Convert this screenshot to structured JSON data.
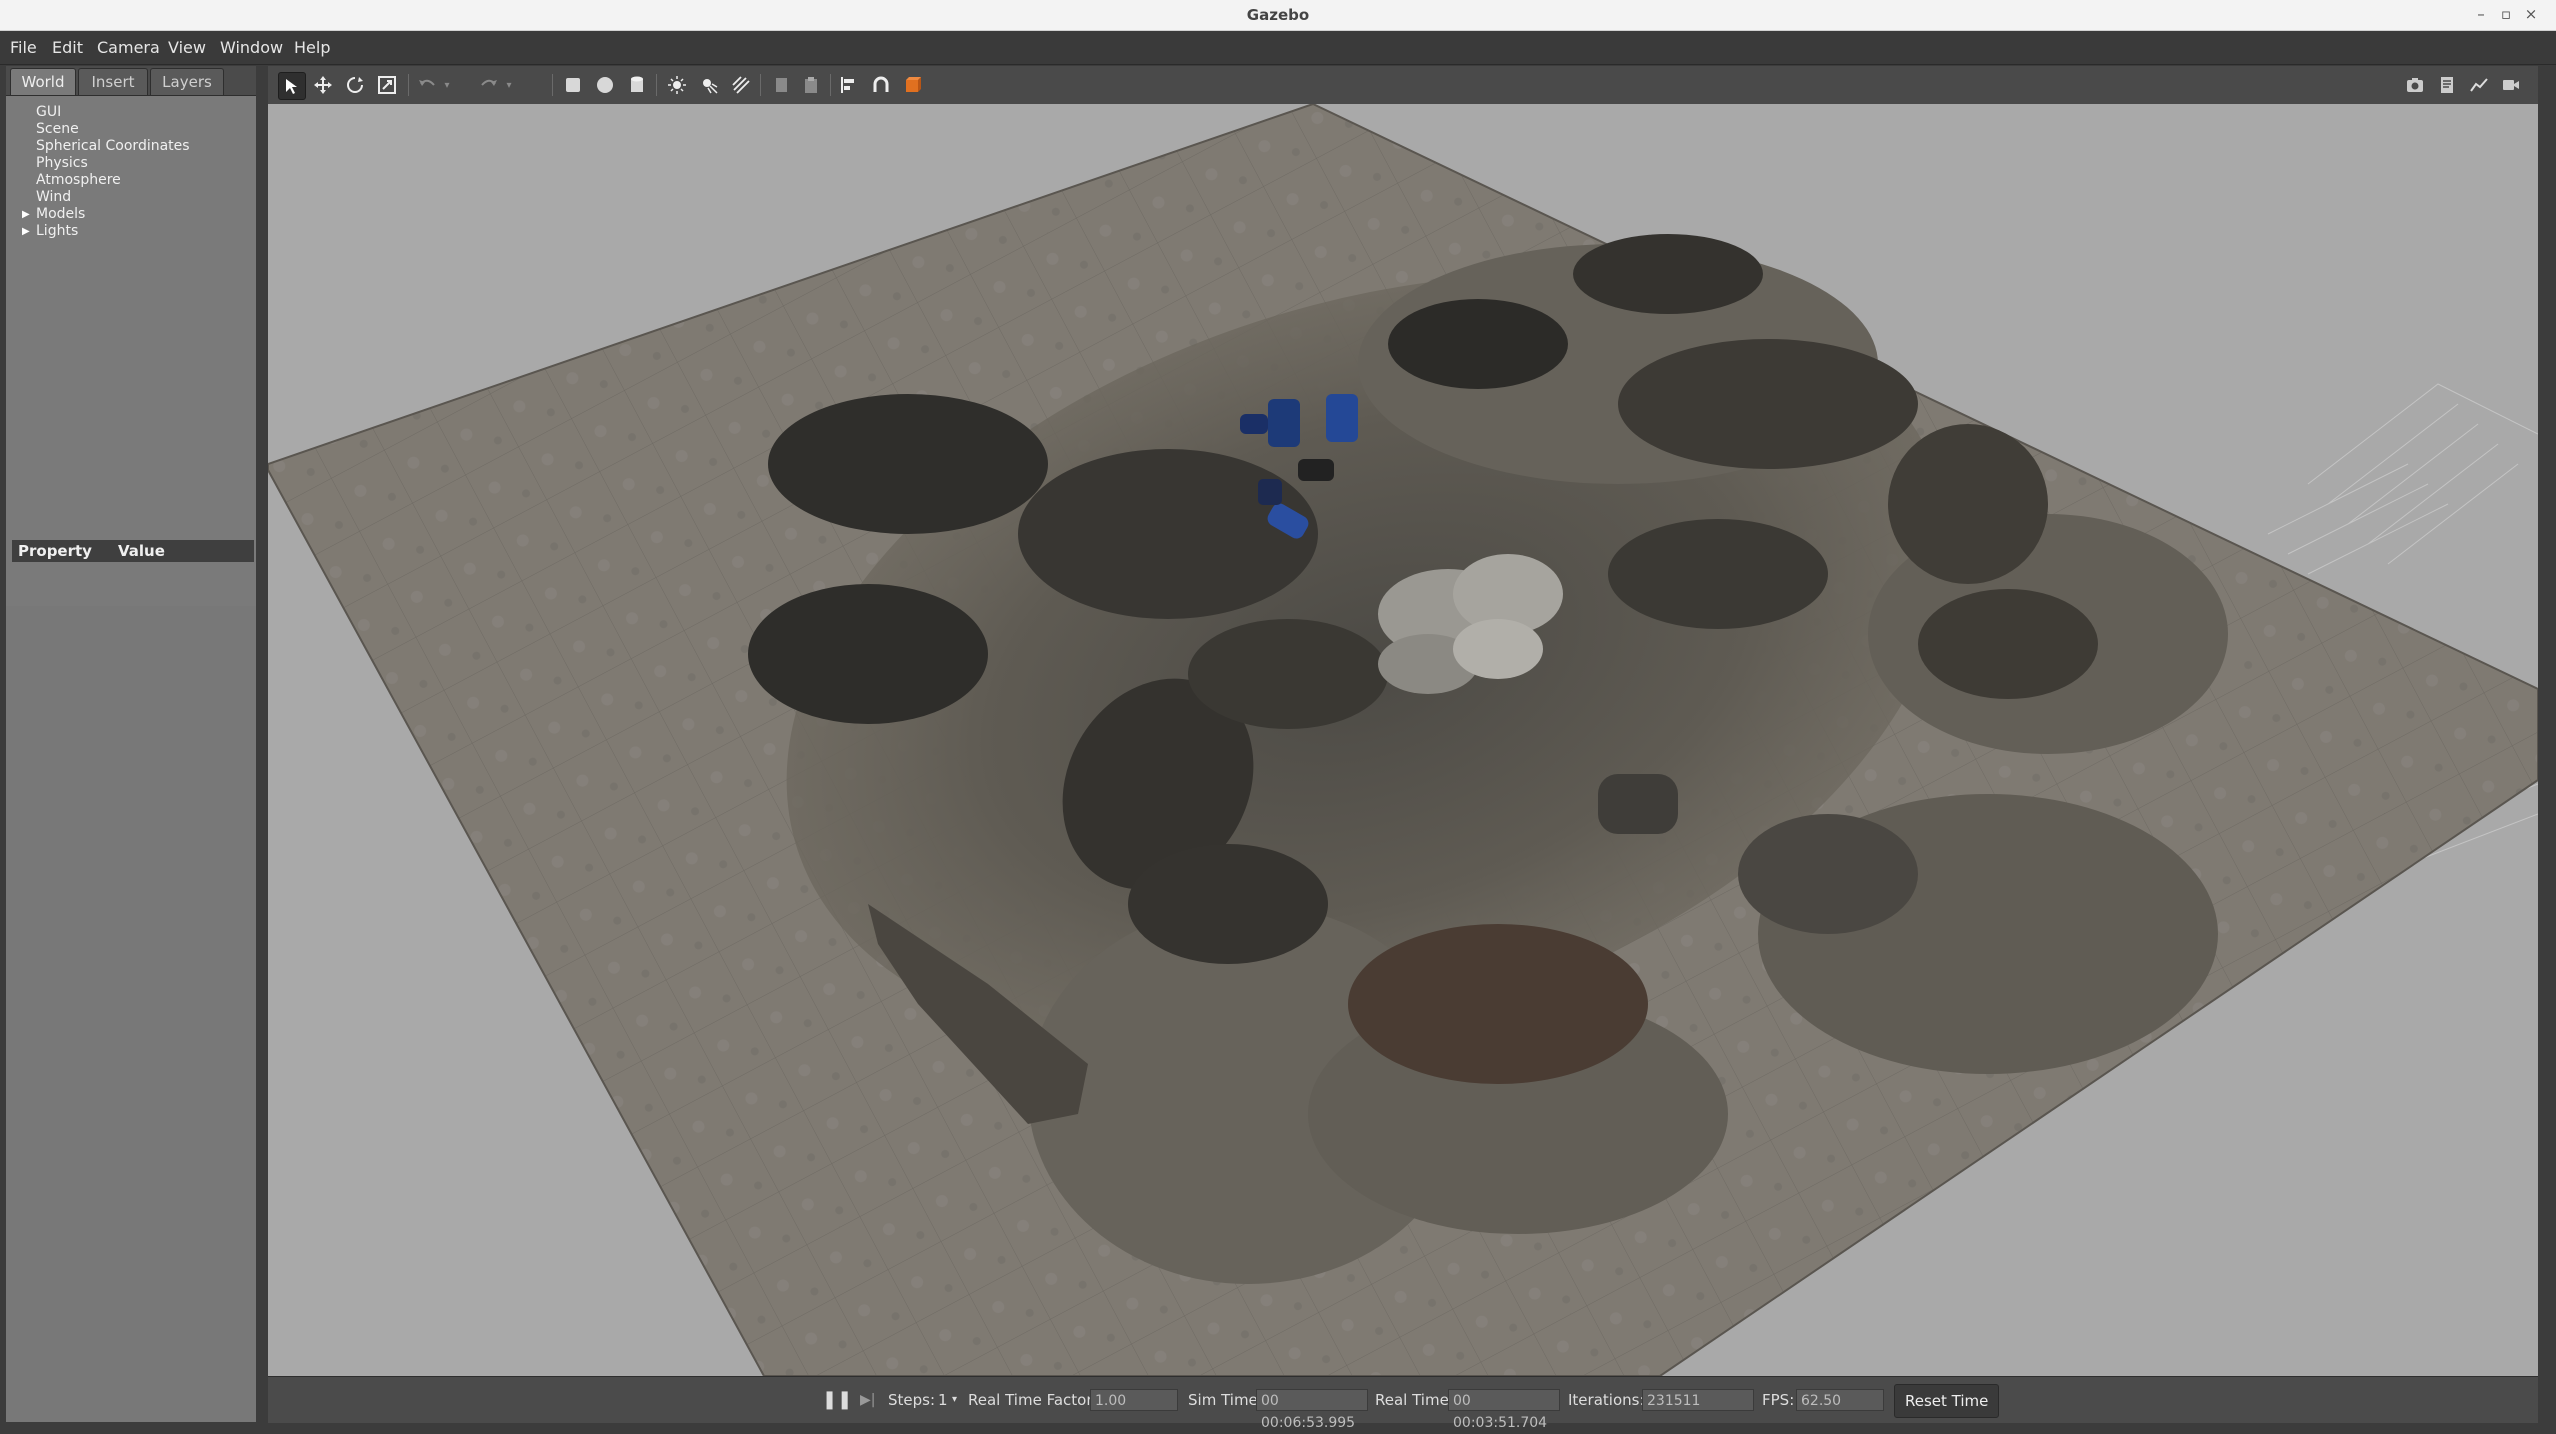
{
  "window": {
    "title": "Gazebo",
    "controls": [
      "–",
      "▫",
      "×"
    ]
  },
  "menu": [
    "File",
    "Edit",
    "Camera",
    "View",
    "Window",
    "Help"
  ],
  "left_panel": {
    "tabs": [
      "World",
      "Insert",
      "Layers"
    ],
    "active_tab": "World",
    "tree": [
      "GUI",
      "Scene",
      "Spherical Coordinates",
      "Physics",
      "Atmosphere",
      "Wind",
      "Models",
      "Lights"
    ],
    "property_header": {
      "property": "Property",
      "value": "Value"
    }
  },
  "toolbar": {
    "left_icons": [
      "select-icon",
      "translate-icon",
      "rotate-icon",
      "scale-icon",
      "undo-icon",
      "undo-dropdown-icon",
      "redo-icon",
      "redo-dropdown-icon",
      "box-icon",
      "sphere-icon",
      "cylinder-icon",
      "point-light-icon",
      "spot-light-icon",
      "directional-light-icon",
      "copy-icon",
      "paste-icon",
      "align-icon",
      "snap-icon",
      "change-view-icon"
    ],
    "right_icons": [
      "screenshot-icon",
      "log-icon",
      "plot-icon",
      "record-icon"
    ]
  },
  "bottom_bar": {
    "steps_label": "Steps:",
    "steps_value": "1",
    "rtf_label": "Real Time Factor:",
    "rtf_value": "1.00",
    "sim_time_label": "Sim Time:",
    "sim_time_value": "00 00:06:53.995",
    "real_time_label": "Real Time:",
    "real_time_value": "00 00:03:51.704",
    "iterations_label": "Iterations:",
    "iterations_value": "231511",
    "fps_label": "FPS:",
    "fps_value": "62.50",
    "reset_label": "Reset Time"
  },
  "colors": {
    "viewport_sky": "#a9a9a9",
    "ground": "#7d7870",
    "panel_bg": "#4b4b4b",
    "tree_bg": "#7a7a7a",
    "accent_orange": "#e07020"
  }
}
